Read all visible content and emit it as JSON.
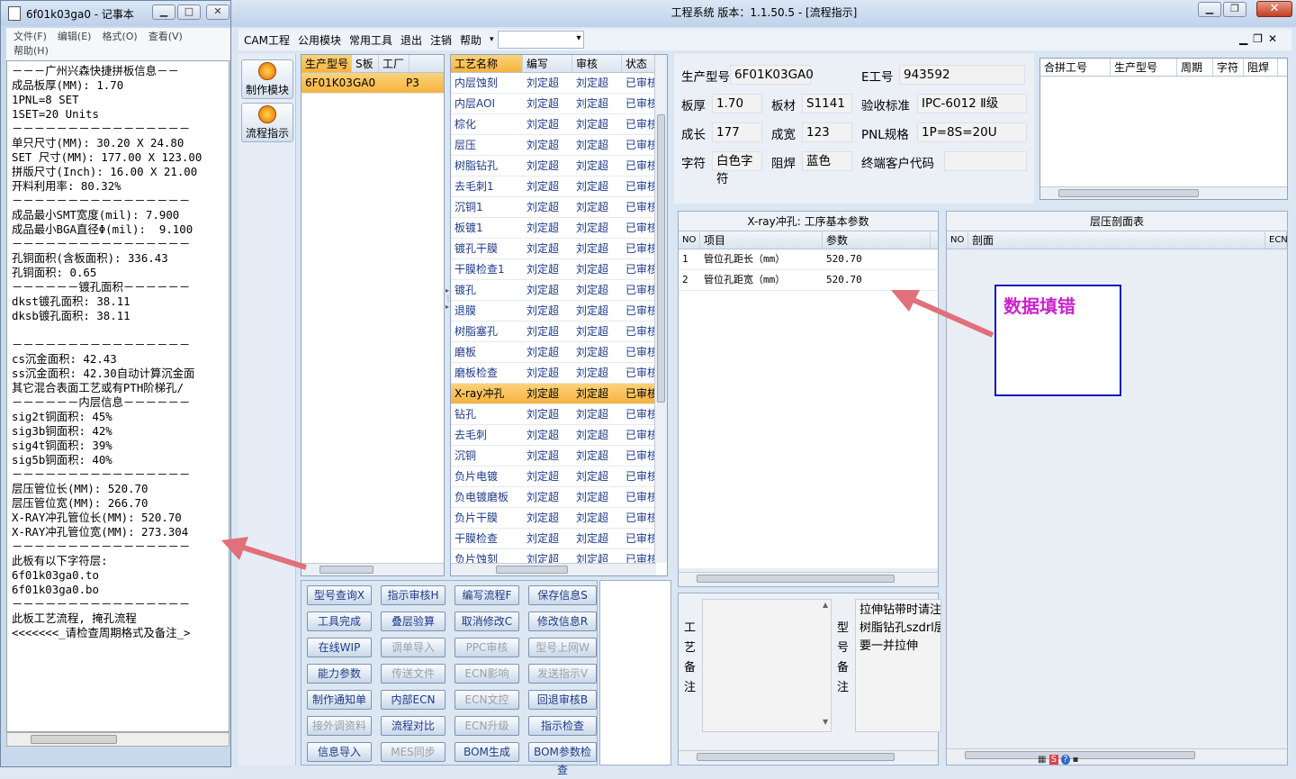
{
  "notepad": {
    "title": "6f01k03ga0 - 记事本",
    "menu": [
      "文件(F)",
      "编辑(E)",
      "格式(O)",
      "查看(V)",
      "帮助(H)"
    ],
    "content": "－－－广州兴森快捷拼板信息－－\n成品板厚(MM): 1.70\n1PNL=8 SET\n1SET=20 Units\n－－－－－－－－－－－－－－－－\n单只尺寸(MM): 30.20 X 24.80\nSET 尺寸(MM): 177.00 X 123.00\n拼版尺寸(Inch): 16.00 X 21.00\n开料利用率: 80.32%\n－－－－－－－－－－－－－－－－\n成品最小SMT宽度(mil): 7.900\n成品最小BGA直径Φ(mil):  9.100\n－－－－－－－－－－－－－－－－\n孔铜面积(含板面积): 336.43\n孔铜面积: 0.65\n－－－－－－镀孔面积－－－－－－\ndkst镀孔面积: 38.11\ndksb镀孔面积: 38.11\n\n－－－－－－－－－－－－－－－－\ncs沉金面积: 42.43\nss沉金面积: 42.30自动计算沉金面\n其它混合表面工艺或有PTH阶梯孔/\n－－－－－－内层信息－－－－－－\nsig2t铜面积: 45%\nsig3b铜面积: 42%\nsig4t铜面积: 39%\nsig5b铜面积: 40%\n－－－－－－－－－－－－－－－－\n层压管位长(MM): 520.70\n层压管位宽(MM): 266.70\nX-RAY冲孔管位长(MM): 520.70\nX-RAY冲孔管位宽(MM): 273.304\n－－－－－－－－－－－－－－－－\n此板有以下字符层:\n6f01k03ga0.to\n6f01k03ga0.bo\n－－－－－－－－－－－－－－－－\n此板工艺流程, 掩孔流程\n<<<<<<<_请检查周期格式及备注_>"
  },
  "main": {
    "title": "工程系统  版本：1.1.50.5 - [流程指示]",
    "menu": [
      "CAM工程",
      "公用模块",
      "常用工具",
      "退出",
      "注销",
      "帮助"
    ],
    "left_toolbar": [
      "制作模块",
      "流程指示"
    ],
    "products": {
      "headers": [
        "生产型号",
        "S板",
        "工厂"
      ],
      "rows": [
        [
          "6F01K03GA0",
          "",
          "P3"
        ]
      ]
    },
    "processes": {
      "headers": [
        "工艺名称",
        "编写",
        "审核",
        "状态"
      ],
      "rows": [
        [
          "内层蚀刻",
          "刘定超",
          "刘定超",
          "已审核"
        ],
        [
          "内层AOI",
          "刘定超",
          "刘定超",
          "已审核"
        ],
        [
          "棕化",
          "刘定超",
          "刘定超",
          "已审核"
        ],
        [
          "层压",
          "刘定超",
          "刘定超",
          "已审核"
        ],
        [
          "树脂钻孔",
          "刘定超",
          "刘定超",
          "已审核"
        ],
        [
          "去毛刺1",
          "刘定超",
          "刘定超",
          "已审核"
        ],
        [
          "沉铜1",
          "刘定超",
          "刘定超",
          "已审核"
        ],
        [
          "板镀1",
          "刘定超",
          "刘定超",
          "已审核"
        ],
        [
          "镀孔干膜",
          "刘定超",
          "刘定超",
          "已审核"
        ],
        [
          "干膜检查1",
          "刘定超",
          "刘定超",
          "已审核"
        ],
        [
          "镀孔",
          "刘定超",
          "刘定超",
          "已审核"
        ],
        [
          "退膜",
          "刘定超",
          "刘定超",
          "已审核"
        ],
        [
          "树脂塞孔",
          "刘定超",
          "刘定超",
          "已审核"
        ],
        [
          "磨板",
          "刘定超",
          "刘定超",
          "已审核"
        ],
        [
          "磨板检查",
          "刘定超",
          "刘定超",
          "已审核"
        ],
        [
          "X-ray冲孔",
          "刘定超",
          "刘定超",
          "已审核"
        ],
        [
          "钻孔",
          "刘定超",
          "刘定超",
          "已审核"
        ],
        [
          "去毛刺",
          "刘定超",
          "刘定超",
          "已审核"
        ],
        [
          "沉铜",
          "刘定超",
          "刘定超",
          "已审核"
        ],
        [
          "负片电镀",
          "刘定超",
          "刘定超",
          "已审核"
        ],
        [
          "负电镀磨板",
          "刘定超",
          "刘定超",
          "已审核"
        ],
        [
          "负片干膜",
          "刘定超",
          "刘定超",
          "已审核"
        ],
        [
          "干膜检查",
          "刘定超",
          "刘定超",
          "已审核"
        ],
        [
          "负片蚀刻",
          "刘定超",
          "刘定超",
          "已审核"
        ]
      ],
      "selected_index": 15
    },
    "buttons": [
      [
        "型号查询X",
        "指示审核H",
        "编写流程F",
        "保存信息S"
      ],
      [
        "工具完成",
        "叠层验算",
        "取消修改C",
        "修改信息R"
      ],
      [
        "在线WIP",
        "调单导入",
        "PPC审核",
        "型号上网W"
      ],
      [
        "能力参数",
        "传送文件",
        "ECN影响",
        "发送指示V"
      ],
      [
        "制作通知单",
        "内部ECN",
        "ECN文控",
        "回退审核B"
      ],
      [
        "接外调资料",
        "流程对比",
        "ECN升级",
        "指示检查"
      ],
      [
        "信息导入",
        "MES同步",
        "BOM生成",
        "BOM参数检查"
      ]
    ],
    "disabled_buttons": [
      "调单导入",
      "PPC审核",
      "型号上网W",
      "传送文件",
      "ECN影响",
      "发送指示V",
      "ECN文控",
      "接外调资料",
      "ECN升级",
      "MES同步"
    ],
    "info": {
      "fields": [
        {
          "label": "生产型号",
          "value": "6F01K03GA0"
        },
        {
          "label": "E工号",
          "value": "943592"
        },
        {
          "label": "板厚",
          "value": "1.70"
        },
        {
          "label": "板材",
          "value": "S1141"
        },
        {
          "label": "验收标准",
          "value": "IPC-6012 Ⅱ级"
        },
        {
          "label": "成长",
          "value": "177"
        },
        {
          "label": "成宽",
          "value": "123"
        },
        {
          "label": "PNL规格",
          "value": "1P=8S=20U"
        },
        {
          "label": "字符",
          "value": "白色字符"
        },
        {
          "label": "阻焊",
          "value": "蓝色"
        },
        {
          "label": "终端客户代码",
          "value": ""
        }
      ]
    },
    "merge_table": {
      "headers": [
        "合拼工号",
        "生产型号",
        "周期",
        "字符",
        "阻焊"
      ]
    },
    "params": {
      "title": "X-ray冲孔: 工序基本参数",
      "headers": [
        "NO",
        "项目",
        "参数"
      ],
      "rows": [
        [
          "1",
          "管位孔距长（mm）",
          "520.70"
        ],
        [
          "2",
          "管位孔距宽（mm）",
          "520.70"
        ]
      ]
    },
    "stack": {
      "title": "层压剖面表",
      "headers": [
        "NO",
        "剖面",
        "ECN"
      ]
    },
    "notes": {
      "process_label": "工艺备注",
      "model_label": "型号备注",
      "model_text": "拉伸钻带时请注\n树脂钻孔szdrl层\n要一并拉伸"
    },
    "callout": "数据填错"
  },
  "colors": {
    "accent_select": "#f6b23f",
    "callout_border": "#1414b4",
    "callout_text": "#cc22cc",
    "arrow": "#e0707a"
  }
}
